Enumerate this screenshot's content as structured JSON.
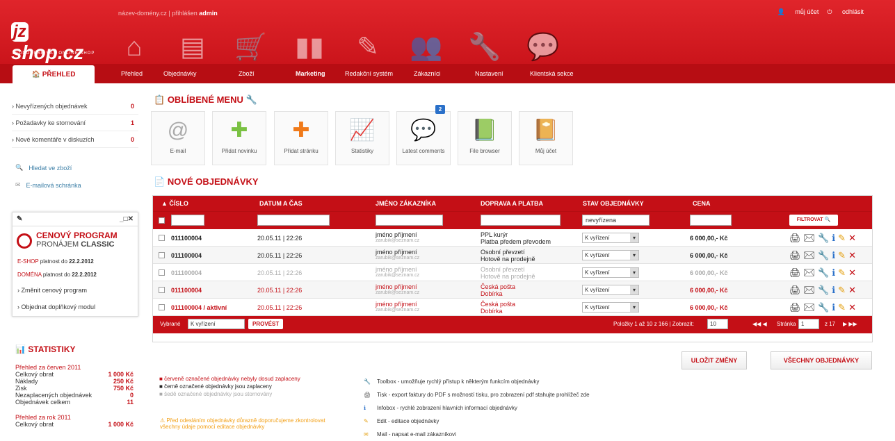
{
  "header": {
    "logo_main": "shop.cz",
    "logo_prefix": "jz",
    "logo_tagline": "JEDNODUŠE VÁŠ ONLINE SHOP",
    "domain": "název-domény.cz",
    "login_text": "| přihlášen",
    "user": "admin",
    "my_account": "můj účet",
    "logout": "odhlásit"
  },
  "nav": {
    "home": "PŘEHLED",
    "tabs": [
      "Přehled",
      "Objednávky",
      "Zboží",
      "Marketing",
      "Redakční systém",
      "Zákazníci",
      "Nastavení",
      "Klientská sekce"
    ]
  },
  "sidebar": {
    "counts": [
      {
        "label": "› Nevyřízených objednávek",
        "value": "0"
      },
      {
        "label": "› Požadavky ke stornování",
        "value": "1"
      },
      {
        "label": "› Nové komentáře v diskuzích",
        "value": "0"
      }
    ],
    "links": [
      "Hledat ve zboží",
      "E-mailová schránka"
    ]
  },
  "program": {
    "title": "CENOVÝ PROGRAM",
    "subtitle_prefix": "PRONÁJEM",
    "subtitle": "CLASSIC",
    "eshop_label": "E-SHOP",
    "eshop_text": "platnost do",
    "eshop_date": "22.2.2012",
    "domain_label": "DOMÉNA",
    "domain_text": "platnost do",
    "domain_date": "22.2.2012",
    "links": [
      "› Změnit cenový program",
      "› Objednat doplňkový modul"
    ]
  },
  "stats": {
    "title": "STATISTIKY",
    "month_title": "Přehled za červen 2011",
    "rows": [
      {
        "label": "Celkový obrat",
        "value": "1 000 Kč"
      },
      {
        "label": "Náklady",
        "value": "250 Kč"
      },
      {
        "label": "Zisk",
        "value": "750 Kč"
      },
      {
        "label": "Nezaplacených objednávek",
        "value": "0"
      },
      {
        "label": "Objednávek celkem",
        "value": "11"
      }
    ],
    "year_title": "Přehled za rok 2011",
    "year_row": {
      "label": "Celkový obrat",
      "value": "1 000 Kč"
    }
  },
  "favorites": {
    "title": "OBLÍBENÉ MENU",
    "items": [
      "E-mail",
      "Přidat novinku",
      "Přidat stránku",
      "Statistiky",
      "Latest comments",
      "File browser",
      "Můj účet"
    ],
    "badge": "2"
  },
  "orders": {
    "title": "NOVÉ OBJEDNÁVKY",
    "headers": [
      "ČÍSLO",
      "DATUM A ČAS",
      "JMÉNO ZÁKAZNÍKA",
      "DOPRAVA A PLATBA",
      "STAV OBJEDNÁVKY",
      "CENA"
    ],
    "filter_status": "nevyřízena",
    "filter_button": "FILTROVAT",
    "rows": [
      {
        "id": "011100004",
        "date": "20.05.11 | 22:26",
        "name": "jméno příjmení",
        "email": "zarubik@seznam.cz",
        "ship": "PPL kurýr",
        "pay": "Platba předem převodem",
        "state": "K vyřízení",
        "price": "6 000,00,- Kč",
        "style": "black"
      },
      {
        "id": "011100004",
        "date": "20.05.11 | 22:26",
        "name": "jméno příjmení",
        "email": "zarubik@seznam.cz",
        "ship": "Osobní převzetí",
        "pay": "Hotově na prodejně",
        "state": "K vyřízení",
        "price": "6 000,00,- Kč",
        "style": "black"
      },
      {
        "id": "011100004",
        "date": "20.05.11 | 22:26",
        "name": "jméno příjmení",
        "email": "zarubik@seznam.cz",
        "ship": "Osobní převzetí",
        "pay": "Hotově na prodejně",
        "state": "K vyřízení",
        "price": "6 000,00,- Kč",
        "style": "gray"
      },
      {
        "id": "011100004",
        "date": "20.05.11 | 22:26",
        "name": "jméno příjmení",
        "email": "zarubik@seznam.cz",
        "ship": "Česká pošta",
        "pay": "Dobírka",
        "state": "K vyřízení",
        "price": "6 000,00,- Kč",
        "style": "red"
      },
      {
        "id": "011100004 / aktivní",
        "date": "20.05.11 | 22:26",
        "name": "jméno příjmení",
        "email": "zarubik@seznam.cz",
        "ship": "Česká pošta",
        "pay": "Dobírka",
        "state": "K vyřízení",
        "price": "6 000,00,- Kč",
        "style": "red"
      }
    ],
    "footer": {
      "selected": "Vybrané",
      "select_value": "K vyřízení",
      "execute": "PROVÉST",
      "items_text": "Položky 1 až 10 z 166 | Zobrazit:",
      "per_page": "10",
      "page_label": "Stránka",
      "page": "1",
      "page_total": "z 17"
    }
  },
  "buttons": {
    "save": "ULOŽIT ZMĚNY",
    "all_orders": "VŠECHNY OBJEDNÁVKY"
  },
  "legend": [
    "červeně označené objednávky nebyly dosud zaplaceny",
    "černě označené objednávky jsou zaplaceny",
    "šedě označené objednávky jsou stornovány"
  ],
  "help": [
    "Toolbox - umožňuje rychlý přístup k některým funkcím objednávky",
    "Tisk - export faktury do PDF s možností tisku, pro zobrazení pdf stahujte prohlížeč zde",
    "Infobox - rychlé zobrazení hlavních informací objednávky",
    "Edit - editace objednávky",
    "Mail - napsat e-mail zákazníkovi"
  ],
  "warning": "Před odesláním objednávky důrazně doporučujeme zkontrolovat všechny údaje pomocí editace objednávky"
}
